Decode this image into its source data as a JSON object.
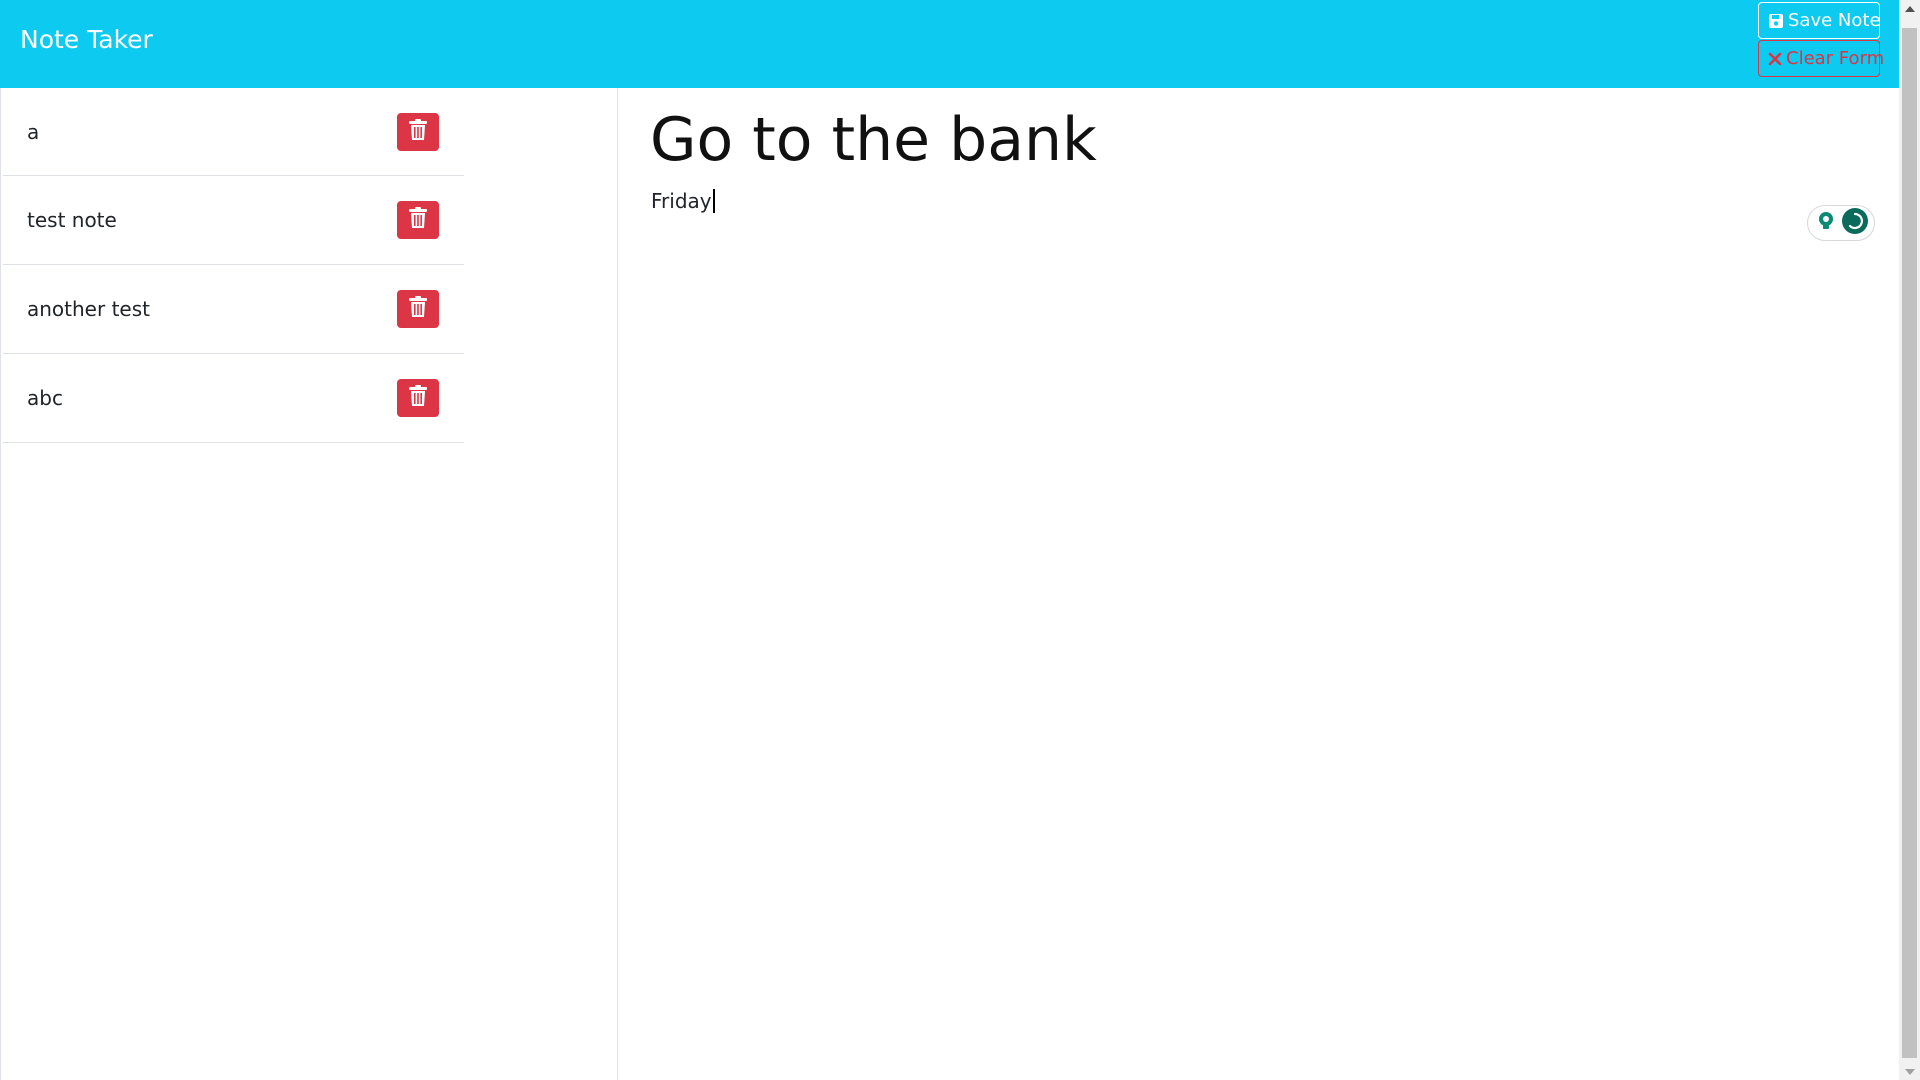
{
  "app": {
    "brand": "Note Taker"
  },
  "toolbar": {
    "save_label": "Save Note",
    "clear_label": "Clear Form",
    "save_icon": "floppy-disk-icon",
    "clear_icon": "x-icon"
  },
  "notes": [
    {
      "title": "a"
    },
    {
      "title": "test note"
    },
    {
      "title": "another test"
    },
    {
      "title": "abc"
    }
  ],
  "editor": {
    "title": "Go to the bank",
    "text": "Friday"
  },
  "colors": {
    "navbar": "#0dcaf0",
    "danger": "#dc3545",
    "text": "#212529",
    "extension_green": "#0b8a73"
  }
}
